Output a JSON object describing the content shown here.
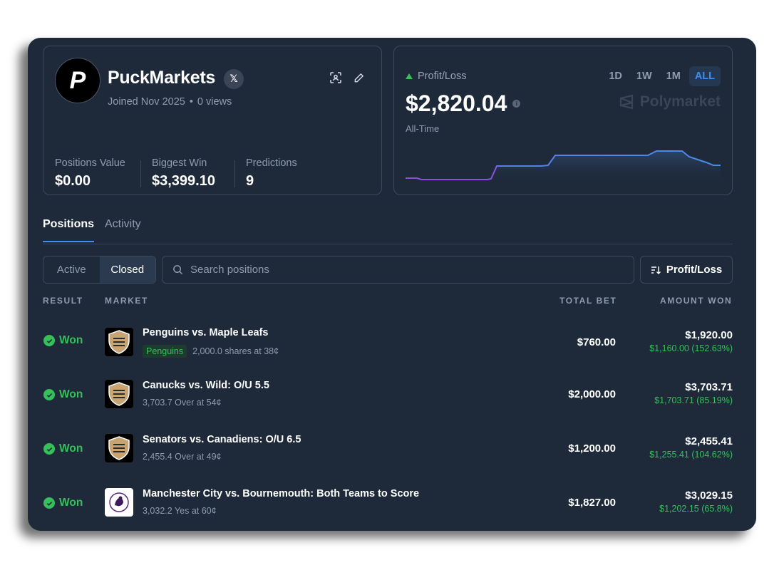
{
  "profile": {
    "avatar_letter": "P",
    "username": "PuckMarkets",
    "joined": "Joined Nov 2025",
    "views": "0 views",
    "stats": [
      {
        "label": "Positions Value",
        "value": "$0.00"
      },
      {
        "label": "Biggest Win",
        "value": "$3,399.10"
      },
      {
        "label": "Predictions",
        "value": "9"
      }
    ]
  },
  "pnl": {
    "label": "Profit/Loss",
    "value": "$2,820.04",
    "period_caption": "All-Time",
    "ranges": [
      "1D",
      "1W",
      "1M",
      "ALL"
    ],
    "active_range": "ALL",
    "brand": "Polymarket",
    "colors": {
      "up": "#35c05a",
      "line_start": "#8a4fe0",
      "line_end": "#4a8be8"
    }
  },
  "tabs": [
    {
      "label": "Positions",
      "active": true
    },
    {
      "label": "Activity",
      "active": false
    }
  ],
  "filters": {
    "active_label": "Active",
    "closed_label": "Closed",
    "search_placeholder": "Search positions",
    "sort_label": "Profit/Loss"
  },
  "table": {
    "headers": {
      "result": "RESULT",
      "market": "MARKET",
      "total_bet": "TOTAL BET",
      "amount_won": "AMOUNT WON"
    },
    "rows": [
      {
        "result": "Won",
        "logo": "nhl-logo",
        "title": "Penguins vs. Maple Leafs",
        "tag": "Penguins",
        "detail": "2,000.0 shares at 38¢",
        "total_bet": "$760.00",
        "amount_won": "$1,920.00",
        "gain": "$1,160.00 (152.63%)"
      },
      {
        "result": "Won",
        "logo": "nhl-logo",
        "title": "Canucks vs. Wild: O/U 5.5",
        "tag": "",
        "detail": "3,703.7 Over at 54¢",
        "total_bet": "$2,000.00",
        "amount_won": "$3,703.71",
        "gain": "$1,703.71 (85.19%)"
      },
      {
        "result": "Won",
        "logo": "nhl-logo",
        "title": "Senators vs. Canadiens: O/U 6.5",
        "tag": "",
        "detail": "2,455.4 Over at 49¢",
        "total_bet": "$1,200.00",
        "amount_won": "$2,455.41",
        "gain": "$1,255.41 (104.62%)"
      },
      {
        "result": "Won",
        "logo": "premier-league-logo",
        "title": "Manchester City vs. Bournemouth: Both Teams to Score",
        "tag": "",
        "detail": "3,032.2 Yes at 60¢",
        "total_bet": "$1,827.00",
        "amount_won": "$3,029.15",
        "gain": "$1,202.15 (65.8%)"
      }
    ]
  }
}
